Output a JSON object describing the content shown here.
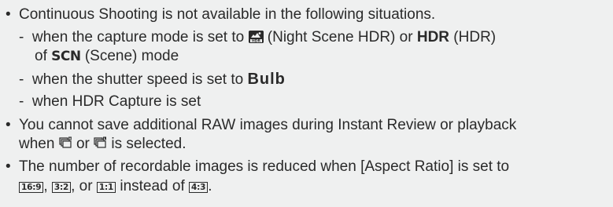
{
  "bullets": [
    {
      "symbol": "•",
      "lines": [
        "Continuous Shooting is not available in the following situations."
      ],
      "sub_items": [
        {
          "dash": "-",
          "part_a": "when the capture mode is set to ",
          "icon_night_scene": "night-scene-hdr-icon",
          "part_b": " (Night Scene HDR) or ",
          "hdr_bold": "HDR",
          "part_c": " (HDR)",
          "part_d": "of ",
          "scn_bold": "SCN",
          "part_e": " (Scene) mode"
        },
        {
          "dash": "-",
          "part_a": "when the shutter speed is set to ",
          "bulb_bold": "Bulb"
        },
        {
          "dash": "-",
          "text": "when HDR Capture is set"
        }
      ]
    },
    {
      "symbol": "•",
      "line1": "You cannot save additional RAW images during Instant Review or playback",
      "line2_a": "when ",
      "icon_a": "continuous-drive-hi-icon",
      "line2_b": " or ",
      "icon_b": "continuous-drive-lo-icon",
      "line2_c": " is selected."
    },
    {
      "symbol": "•",
      "line1": "The number of recordable images is reduced when [Aspect Ratio] is set to",
      "ratio_169": "16:9",
      "sep1": ", ",
      "ratio_32": "3:2",
      "sep2": ", or ",
      "ratio_11": "1:1",
      "sep3": " instead of ",
      "ratio_43": "4:3",
      "end": "."
    }
  ]
}
